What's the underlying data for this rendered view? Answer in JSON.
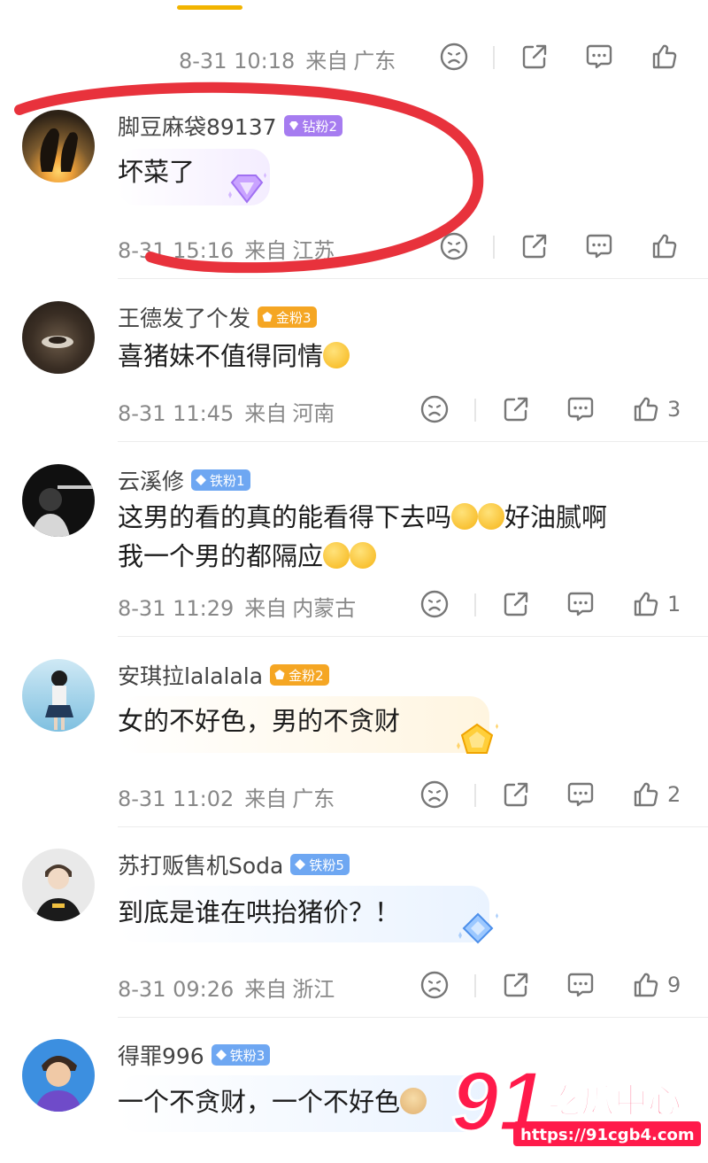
{
  "top_row": {
    "date": "8-31 10:18",
    "from": "来自",
    "location": "广东"
  },
  "comments": [
    {
      "username": "脚豆麻袋89137",
      "badge": "钻粉2",
      "text": "坏菜了",
      "date": "8-31 15:16",
      "from": "来自",
      "location": "江苏",
      "likes": ""
    },
    {
      "username": "王德发了个发",
      "badge": "金粉3",
      "text": "喜猪妹不值得同情",
      "date": "8-31 11:45",
      "from": "来自",
      "location": "河南",
      "likes": "3"
    },
    {
      "username": "云溪修",
      "badge": "铁粉1",
      "text_line1": "这男的看的真的能看得下去吗",
      "text_line1b": "好油腻啊",
      "text_line2": "我一个男的都隔应",
      "date": "8-31 11:29",
      "from": "来自",
      "location": "内蒙古",
      "likes": "1"
    },
    {
      "username": "安琪拉lalalala",
      "badge": "金粉2",
      "text": "女的不好色，男的不贪财",
      "date": "8-31 11:02",
      "from": "来自",
      "location": "广东",
      "likes": "2"
    },
    {
      "username": "苏打贩售机Soda",
      "badge": "铁粉5",
      "text": "到底是谁在哄抬猪价？！",
      "date": "8-31 09:26",
      "from": "来自",
      "location": "浙江",
      "likes": "9"
    },
    {
      "username": "得罪996",
      "badge": "铁粉3",
      "text": "一个不贪财，一个不好色"
    }
  ],
  "watermark": {
    "number": "91",
    "brand": "吃瓜中心",
    "url": "https://91cgb4.com"
  },
  "colors": {
    "accent": "#f2b400",
    "annotation": "#e8323c",
    "diamond_badge": "#a67cf0",
    "gold_badge": "#f5a623",
    "iron_badge": "#6ea7f2"
  },
  "icons": [
    "dislike-icon",
    "share-icon",
    "comment-icon",
    "like-icon"
  ]
}
